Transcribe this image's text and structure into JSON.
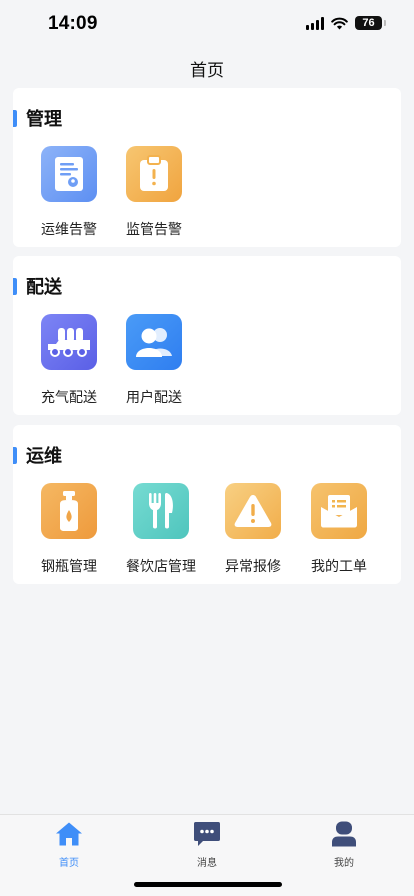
{
  "status_bar": {
    "time": "14:09",
    "battery": "76"
  },
  "nav": {
    "title": "首页"
  },
  "sections": [
    {
      "title": "管理",
      "items": [
        {
          "label": "运维告警",
          "icon": "certificate-icon",
          "color": "#6f9ef5"
        },
        {
          "label": "监管告警",
          "icon": "clipboard-alert-icon",
          "color": "#f3b24e"
        }
      ]
    },
    {
      "title": "配送",
      "items": [
        {
          "label": "充气配送",
          "icon": "gas-truck-icon",
          "color": "#6b72f0"
        },
        {
          "label": "用户配送",
          "icon": "users-icon",
          "color": "#3c8ef5"
        }
      ]
    },
    {
      "title": "运维",
      "items": [
        {
          "label": "钢瓶管理",
          "icon": "gas-bottle-icon",
          "color": "#f0a548"
        },
        {
          "label": "餐饮店管理",
          "icon": "cutlery-icon",
          "color": "#5dcfc6"
        },
        {
          "label": "异常报修",
          "icon": "warning-icon",
          "color": "#f5bf62"
        },
        {
          "label": "我的工单",
          "icon": "work-order-icon",
          "color": "#f2b54f"
        }
      ]
    }
  ],
  "tabbar": {
    "items": [
      {
        "label": "首页",
        "icon": "home-icon",
        "active": true
      },
      {
        "label": "消息",
        "icon": "message-icon",
        "active": false
      },
      {
        "label": "我的",
        "icon": "user-profile-icon",
        "active": false
      }
    ]
  },
  "colors": {
    "accent": "#3f8ef8",
    "tab_icon": "#3f4e7a"
  }
}
